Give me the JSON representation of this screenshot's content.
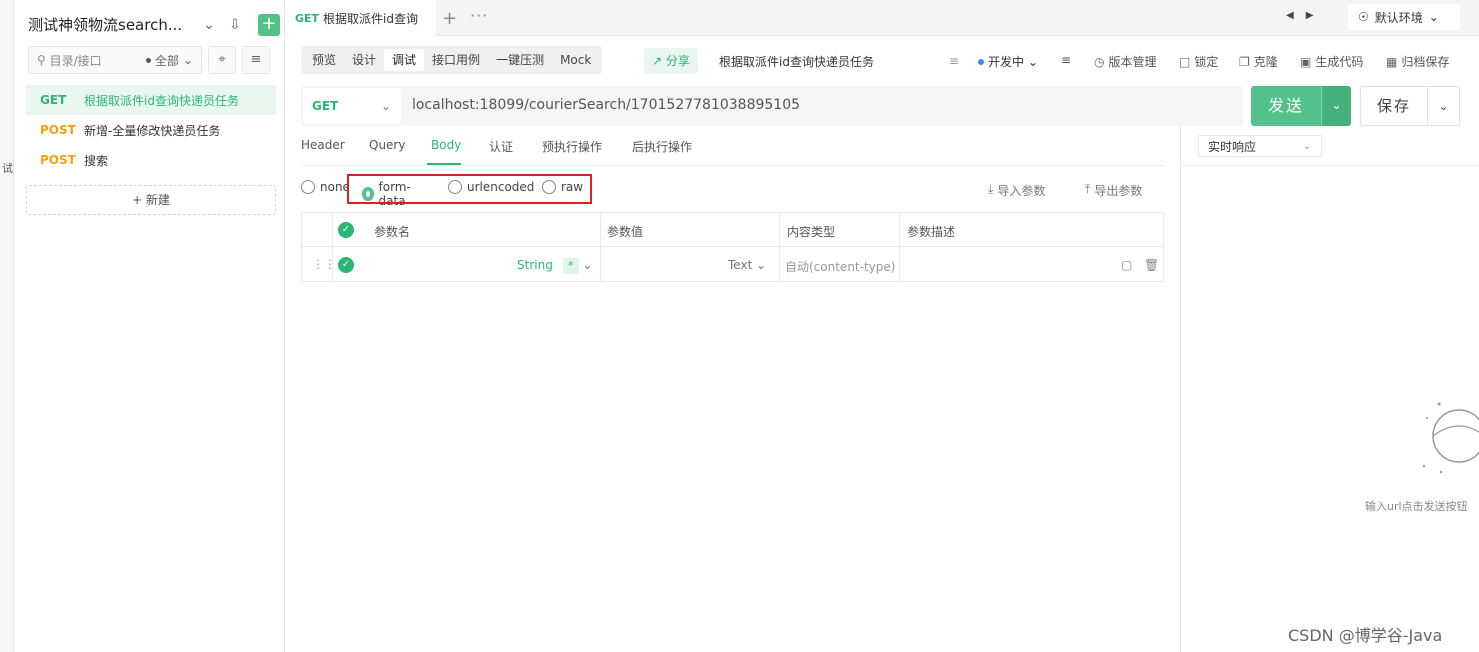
{
  "leftstrip": {
    "text": "试"
  },
  "sidebar": {
    "project_title": "测试神领物流search...",
    "search_placeholder": "目录/接口",
    "filter_label": "全部",
    "new_label": "+ 新建",
    "items": [
      {
        "method": "GET",
        "name": "根据取派件id查询快递员任务"
      },
      {
        "method": "POST",
        "name": "新增-全量修改快递员任务"
      },
      {
        "method": "POST",
        "name": "搜索"
      }
    ]
  },
  "tabs": {
    "active": {
      "method": "GET",
      "title": "根据取派件id查询"
    },
    "add": "+",
    "more": "···",
    "env_label": "默认环境"
  },
  "toolbar": {
    "modes": [
      "预览",
      "设计",
      "调试",
      "接口用例",
      "一键压测",
      "Mock"
    ],
    "active_mode": "调试",
    "share_label": "分享",
    "api_name": "根据取派件id查询快递员任务",
    "status_label": "开发中",
    "links": [
      "版本管理",
      "锁定",
      "克隆",
      "生成代码",
      "归档保存"
    ]
  },
  "request": {
    "method": "GET",
    "url": "localhost:18099/courierSearch/1701527781038895105",
    "send_label": "发送",
    "save_label": "保存"
  },
  "subtabs": {
    "items": [
      "Header",
      "Query",
      "Body",
      "认证",
      "预执行操作",
      "后执行操作"
    ],
    "active": "Body"
  },
  "body_types": {
    "options": [
      "none",
      "form-data",
      "urlencoded",
      "raw"
    ],
    "selected": "form-data",
    "import_label": "导入参数",
    "export_label": "导出参数"
  },
  "params_table": {
    "headers": [
      "参数名",
      "参数值",
      "内容类型",
      "参数描述"
    ],
    "rows": [
      {
        "type": "String",
        "required": "*",
        "value_type": "Text",
        "content_type_placeholder": "自动(content-type)"
      }
    ]
  },
  "response": {
    "mode_label": "实时响应",
    "empty_hint": "输入url点击发送按钮"
  },
  "watermark": "CSDN @博学谷-Java",
  "colors": {
    "accent": "#52c18a",
    "get": "#2bb673",
    "post": "#f2a30b",
    "highlight": "#e02020"
  }
}
